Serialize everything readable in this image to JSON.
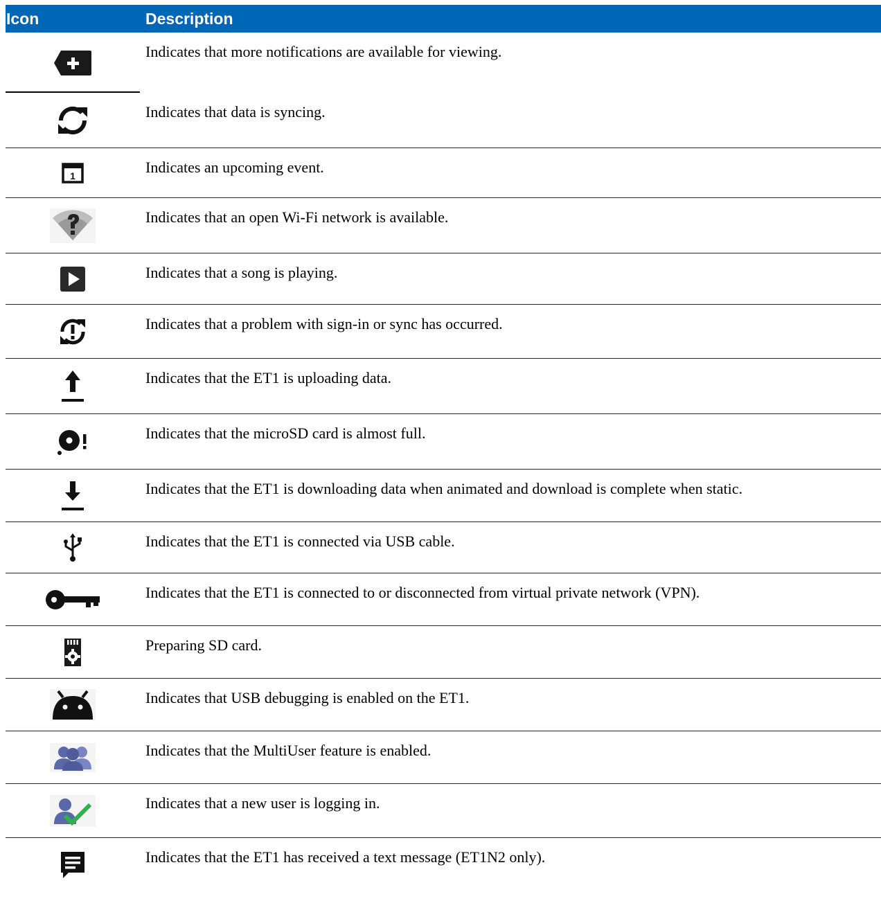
{
  "table": {
    "headers": {
      "icon": "Icon",
      "description": "Description"
    },
    "rows": [
      {
        "icon": "more-notifications-icon",
        "description": "Indicates that more notifications are available for viewing."
      },
      {
        "icon": "sync-icon",
        "description": "Indicates that data is syncing."
      },
      {
        "icon": "calendar-event-icon",
        "description": "Indicates an upcoming event."
      },
      {
        "icon": "open-wifi-icon",
        "description": "Indicates that an open Wi-Fi network is available."
      },
      {
        "icon": "song-playing-icon",
        "description": "Indicates that a song is playing."
      },
      {
        "icon": "sync-problem-icon",
        "description": "Indicates that a problem with sign-in or sync has occurred."
      },
      {
        "icon": "upload-icon",
        "description": "Indicates that the ET1 is uploading data."
      },
      {
        "icon": "sd-card-full-icon",
        "description": "Indicates that the microSD card is almost full."
      },
      {
        "icon": "download-icon",
        "description": "Indicates that the ET1 is downloading data when animated and download is complete when static."
      },
      {
        "icon": "usb-icon",
        "description": "Indicates that the ET1 is connected via USB cable."
      },
      {
        "icon": "vpn-key-icon",
        "description": "Indicates that the ET1 is connected to or disconnected from virtual private network (VPN)."
      },
      {
        "icon": "preparing-sd-card-icon",
        "description": "Preparing SD card."
      },
      {
        "icon": "usb-debugging-icon",
        "description": "Indicates that USB debugging is enabled on the ET1."
      },
      {
        "icon": "multiuser-icon",
        "description": "Indicates that the MultiUser feature is enabled."
      },
      {
        "icon": "user-login-icon",
        "description": "Indicates that a new user is logging in."
      },
      {
        "icon": "text-message-icon",
        "description": "Indicates that the ET1 has received a text message (ET1N2 only)."
      }
    ]
  }
}
